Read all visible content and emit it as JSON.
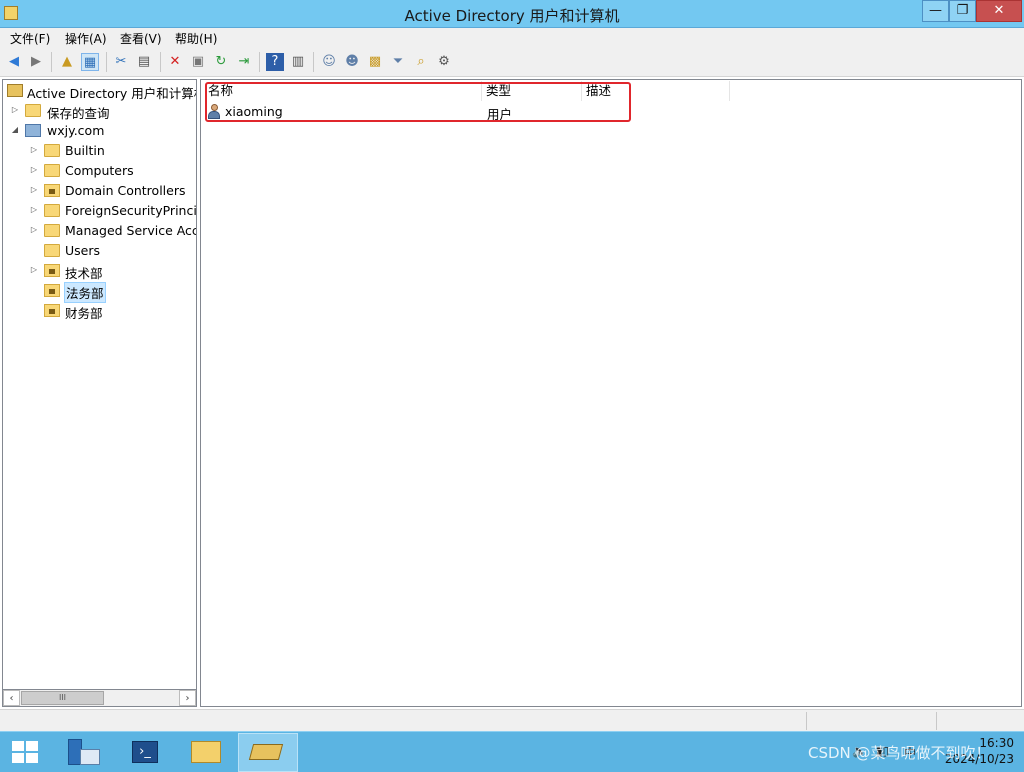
{
  "window": {
    "title": "Active Directory 用户和计算机",
    "controls": {
      "minimize": "—",
      "maximize": "❐",
      "close": "✕"
    }
  },
  "menu": [
    "文件(F)",
    "操作(A)",
    "查看(V)",
    "帮助(H)"
  ],
  "toolbar_icons": [
    "back-icon",
    "forward-icon",
    "up-folder-icon",
    "show-tree-icon",
    "cut-icon",
    "copy-icon",
    "delete-icon",
    "properties-icon",
    "refresh-icon",
    "export-list-icon",
    "help-icon",
    "console-icon",
    "new-user-icon",
    "new-group-icon",
    "new-ou-icon",
    "filter-icon",
    "find-icon",
    "delegate-icon"
  ],
  "tree": {
    "root": "Active Directory 用户和计算机",
    "saved_queries": "保存的查询",
    "domain": "wxjy.com",
    "children": [
      {
        "label": "Builtin",
        "kind": "folder",
        "expandable": true
      },
      {
        "label": "Computers",
        "kind": "folder",
        "expandable": true
      },
      {
        "label": "Domain Controllers",
        "kind": "ou",
        "expandable": true
      },
      {
        "label": "ForeignSecurityPrincipa",
        "kind": "folder",
        "expandable": true
      },
      {
        "label": "Managed Service Acco",
        "kind": "folder",
        "expandable": true
      },
      {
        "label": "Users",
        "kind": "folder",
        "expandable": false
      },
      {
        "label": "技术部",
        "kind": "ou",
        "expandable": true
      },
      {
        "label": "法务部",
        "kind": "ou",
        "expandable": false,
        "selected": true
      },
      {
        "label": "财务部",
        "kind": "ou",
        "expandable": false
      }
    ]
  },
  "list": {
    "columns": [
      "名称",
      "类型",
      "描述"
    ],
    "rows": [
      {
        "name": "xiaoming",
        "type": "用户",
        "description": ""
      }
    ]
  },
  "taskbar": {
    "items": [
      "server-manager-icon",
      "powershell-icon",
      "file-explorer-icon",
      "ad-users-computers-icon"
    ],
    "clock_time": "16:30",
    "clock_date": "2024/10/23"
  },
  "watermark": "CSDN @菜鸟呢做不到吹！"
}
